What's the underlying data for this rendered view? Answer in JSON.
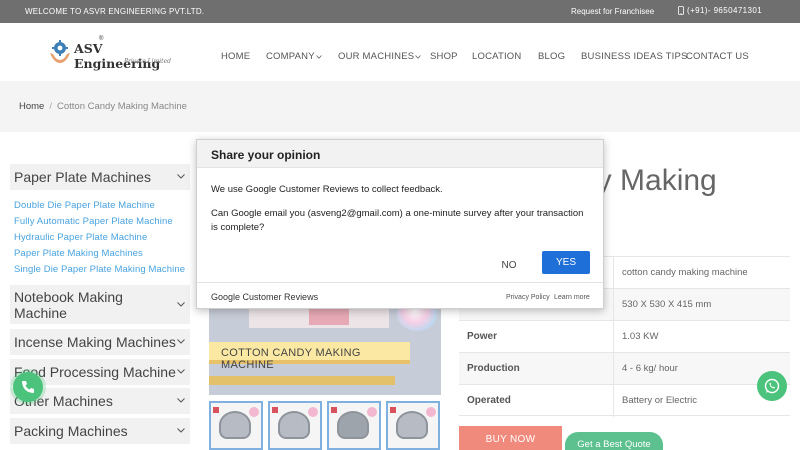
{
  "topbar": {
    "welcome": "WELCOME TO ASVR ENGINEERING PVT.LTD.",
    "franchise": "Request for Franchisee",
    "phone": "(+91)- 9650471301"
  },
  "logo": {
    "name": "ASV Engineering",
    "reg": "®",
    "sub": "Private Limited"
  },
  "nav": {
    "home": "HOME",
    "company": "COMPANY",
    "machines": "OUR MACHINES",
    "shop": "SHOP",
    "location": "LOCATION",
    "blog": "BLOG",
    "tips": "BUSINESS IDEAS TIPS",
    "contact": "CONTACT US"
  },
  "breadcrumb": {
    "home": "Home",
    "separator": "/",
    "current": "Cotton Candy Making Machine"
  },
  "sidebar": {
    "cat1": "Paper Plate Machines",
    "links": [
      "Double Die Paper Plate Machine",
      "Fully Automatic Paper Plate Machine",
      "Hydraulic Paper Plate Machine",
      "Paper Plate Making Machines",
      "Single Die Paper Plate Making Machine"
    ],
    "cat2": "Notebook Making Machine",
    "cat3": "Incense Making Machines",
    "cat4": "Food Processing Machine",
    "cat5": "Other Machines",
    "cat6": "Packing Machines"
  },
  "product": {
    "headline": "dy Making",
    "image_banner": "COTTON CANDY MAKING MACHINE",
    "specs": [
      {
        "key": "",
        "value": "cotton candy making machine"
      },
      {
        "key": "",
        "value": "530 X 530 X 415 mm"
      },
      {
        "key": "Power",
        "value": "1.03 KW"
      },
      {
        "key": "Production",
        "value": "4 - 6 kg/ hour"
      },
      {
        "key": "Operated",
        "value": "Battery or Electric"
      }
    ],
    "buy": "BUY NOW",
    "quote": "Get a Best Quote"
  },
  "dialog": {
    "title": "Share your opinion",
    "line1": "We use Google Customer Reviews to collect feedback.",
    "line2": "Can Google email you (asveng2@gmail.com) a one-minute survey after your transaction is complete?",
    "no": "NO",
    "yes": "YES",
    "brand_google": "Google",
    "brand_rest": "Customer Reviews",
    "privacy": "Privacy Policy",
    "learn": "Learn more"
  },
  "colors": {
    "accent_blue": "#1f6fd8",
    "link_blue": "#4aa3df",
    "green": "#4cc37c",
    "salmon": "#f08a7d"
  }
}
